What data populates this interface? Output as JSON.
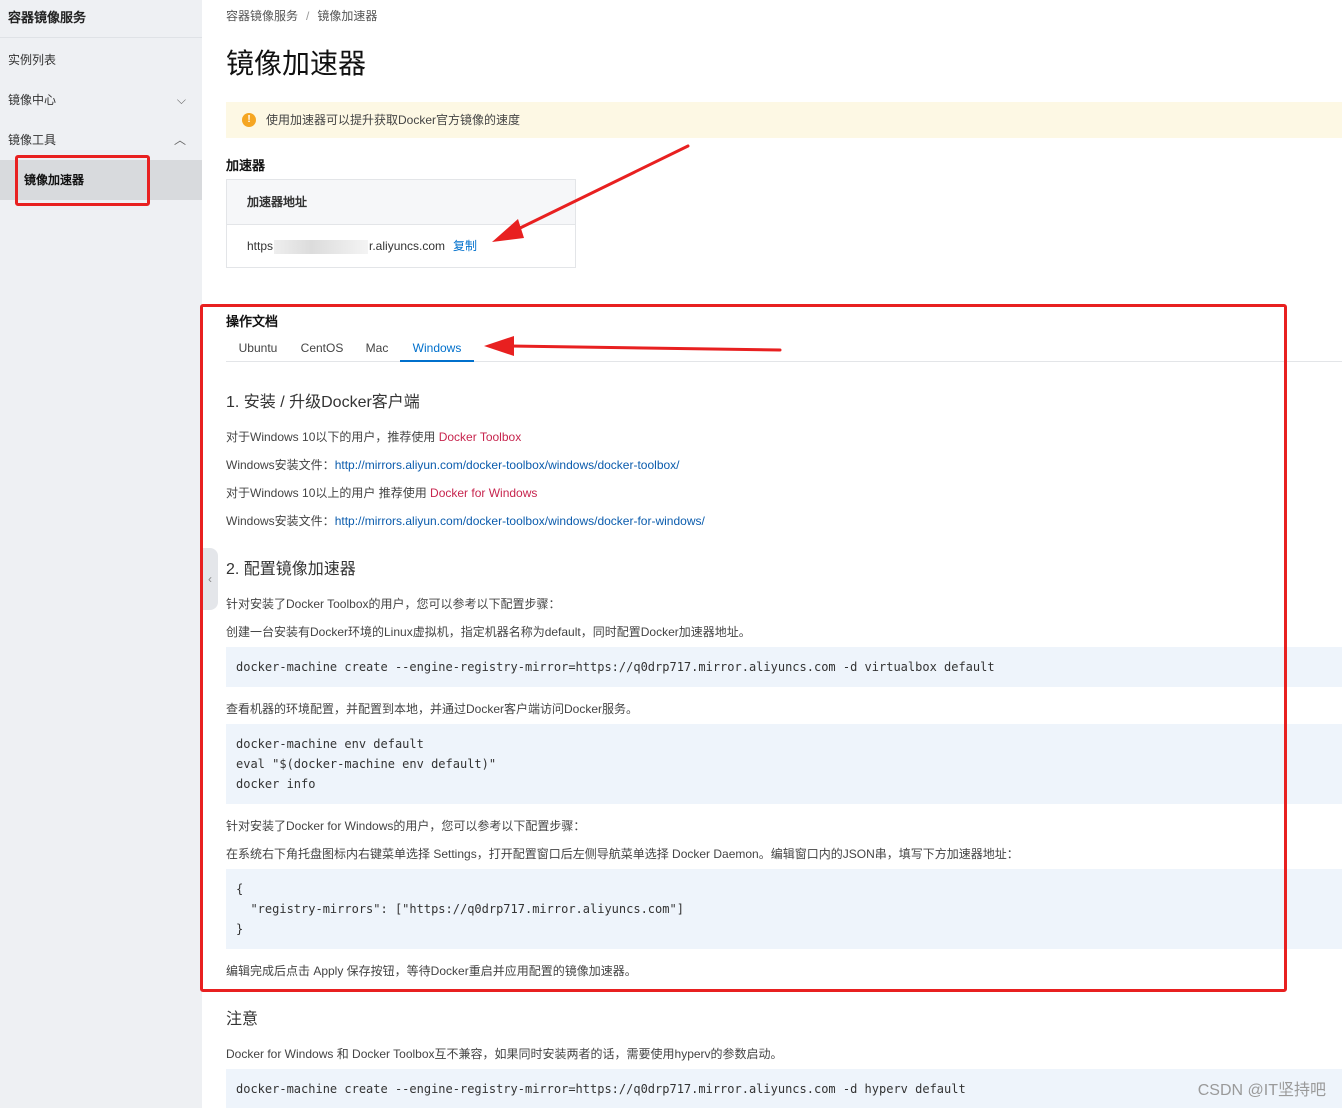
{
  "sidebar": {
    "title": "容器镜像服务",
    "items": [
      {
        "label": "实例列表",
        "chevron": ""
      },
      {
        "label": "镜像中心",
        "chevron": "⌵"
      },
      {
        "label": "镜像工具",
        "chevron": "︿"
      },
      {
        "label": "镜像加速器",
        "chevron": ""
      }
    ]
  },
  "breadcrumb": {
    "root": "容器镜像服务",
    "sep": "/",
    "current": "镜像加速器"
  },
  "page_title": "镜像加速器",
  "notice": {
    "icon": "warning-icon",
    "text": "使用加速器可以提升获取Docker官方镜像的速度"
  },
  "accelerator": {
    "section_label": "加速器",
    "header": "加速器地址",
    "url_prefix": "https",
    "url_suffix": "r.aliyuncs.com",
    "copy_label": "复制"
  },
  "docs": {
    "section_label": "操作文档",
    "tabs": [
      "Ubuntu",
      "CentOS",
      "Mac",
      "Windows"
    ],
    "active_tab": "Windows",
    "step1": {
      "title": "1. 安装 / 升级Docker客户端",
      "l1_text": "对于Windows 10以下的用户，推荐使用 ",
      "l1_link": "Docker Toolbox",
      "l2_text": "Windows安装文件：",
      "l2_link": "http://mirrors.aliyun.com/docker-toolbox/windows/docker-toolbox/",
      "l3_text": "对于Windows 10以上的用户 推荐使用 ",
      "l3_link": "Docker for Windows",
      "l4_text": "Windows安装文件：",
      "l4_link": "http://mirrors.aliyun.com/docker-toolbox/windows/docker-for-windows/"
    },
    "step2": {
      "title": "2. 配置镜像加速器",
      "p1": "针对安装了Docker Toolbox的用户，您可以参考以下配置步骤：",
      "p2": "创建一台安装有Docker环境的Linux虚拟机，指定机器名称为default，同时配置Docker加速器地址。",
      "code1": "docker-machine create --engine-registry-mirror=https://q0drp717.mirror.aliyuncs.com -d virtualbox default",
      "p3": "查看机器的环境配置，并配置到本地，并通过Docker客户端访问Docker服务。",
      "code2": "docker-machine env default\neval \"$(docker-machine env default)\"\ndocker info",
      "p4": "针对安装了Docker for Windows的用户，您可以参考以下配置步骤：",
      "p5": "在系统右下角托盘图标内右键菜单选择 Settings，打开配置窗口后左侧导航菜单选择 Docker Daemon。编辑窗口内的JSON串，填写下方加速器地址：",
      "code3": "{\n  \"registry-mirrors\": [\"https://q0drp717.mirror.aliyuncs.com\"]\n}",
      "p6": "编辑完成后点击 Apply 保存按钮，等待Docker重启并应用配置的镜像加速器。"
    },
    "note": {
      "title": "注意",
      "text": "Docker for Windows 和 Docker Toolbox互不兼容，如果同时安装两者的话，需要使用hyperv的参数启动。",
      "code": "docker-machine create --engine-registry-mirror=https://q0drp717.mirror.aliyuncs.com -d hyperv default"
    }
  },
  "watermark": "CSDN @IT坚持吧",
  "colors": {
    "annotation": "#e82020",
    "link": "#0070cc",
    "highlight_link": "#c7254e"
  }
}
